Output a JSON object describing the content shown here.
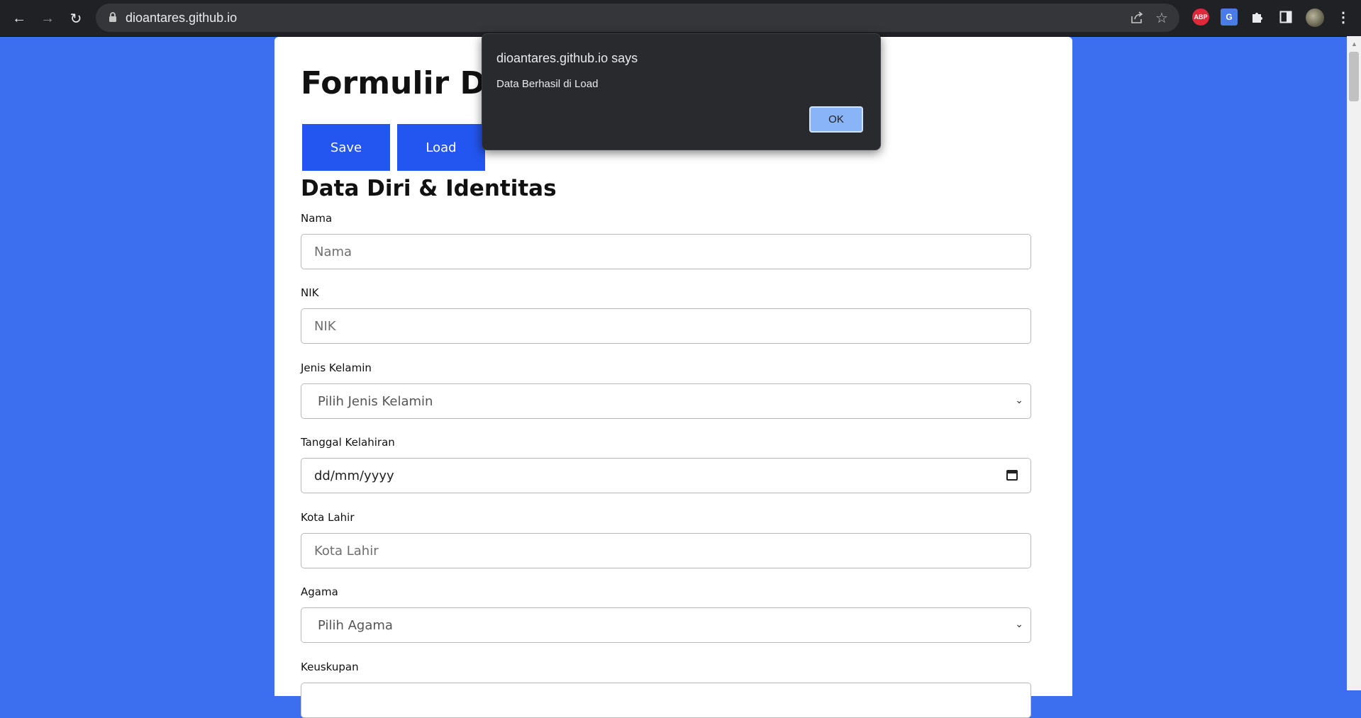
{
  "browser": {
    "url": "dioantares.github.io"
  },
  "page": {
    "title": "Formulir Data",
    "save_label": "Save",
    "load_label": "Load",
    "section_title": "Data Diri & Identitas",
    "fields": {
      "nama": {
        "label": "Nama",
        "placeholder": "Nama"
      },
      "nik": {
        "label": "NIK",
        "placeholder": "NIK"
      },
      "jenis_kelamin": {
        "label": "Jenis Kelamin",
        "value": "Pilih Jenis Kelamin"
      },
      "tanggal": {
        "label": "Tanggal Kelahiran",
        "value": "dd/mm/yyyy"
      },
      "kota": {
        "label": "Kota Lahir",
        "placeholder": "Kota Lahir"
      },
      "agama": {
        "label": "Agama",
        "value": "Pilih Agama"
      },
      "keuskupan": {
        "label": "Keuskupan"
      }
    }
  },
  "dialog": {
    "title": "dioantares.github.io says",
    "message": "Data Berhasil di Load",
    "ok_label": "OK"
  },
  "colors": {
    "page_background": "#3c6ef0",
    "button": "#2356f0",
    "dialog_background": "#292a2d",
    "ok_button": "#8ab4f8"
  }
}
